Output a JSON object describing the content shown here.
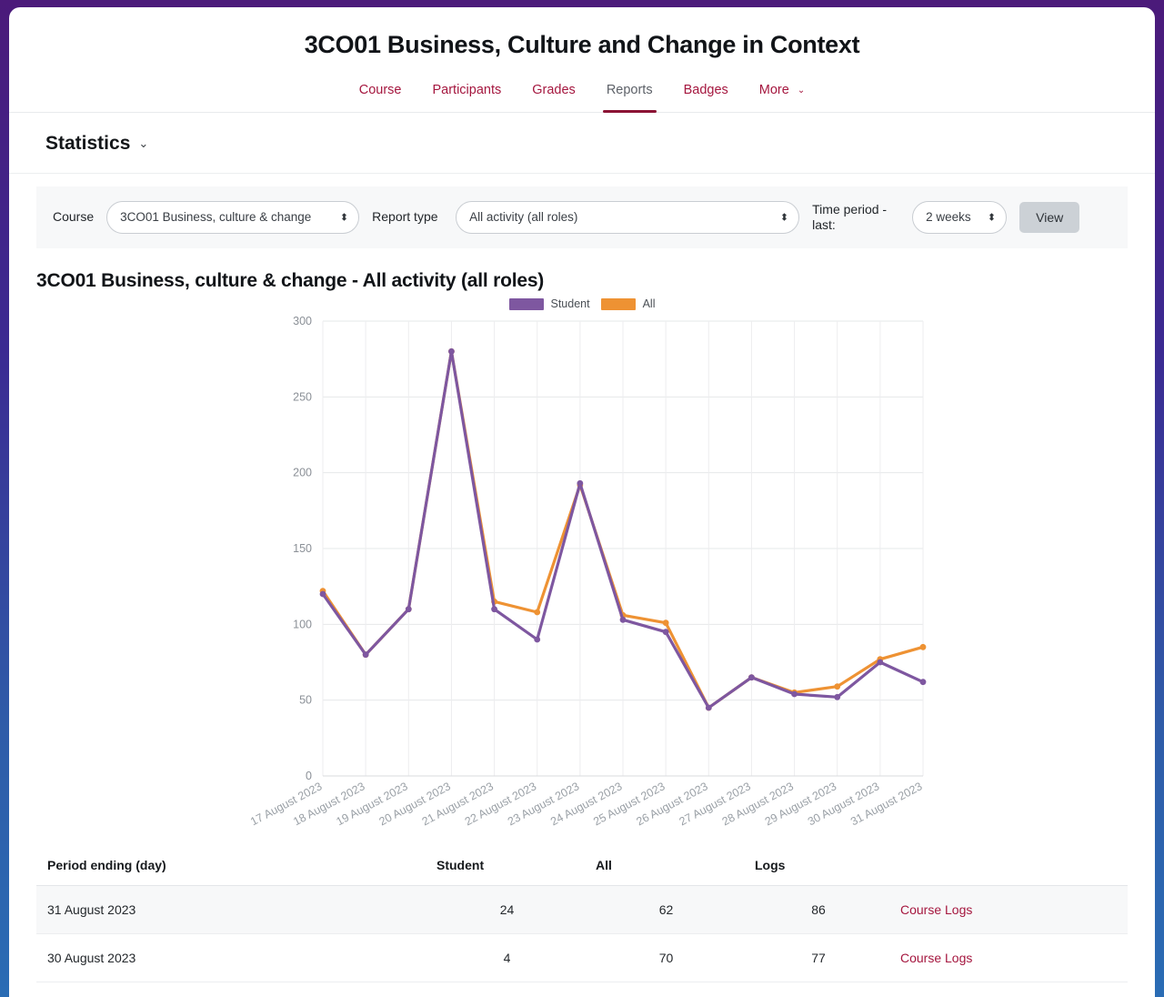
{
  "header": {
    "course_title": "3CO01 Business, Culture and Change in Context",
    "tabs": [
      {
        "label": "Course",
        "active": false
      },
      {
        "label": "Participants",
        "active": false
      },
      {
        "label": "Grades",
        "active": false
      },
      {
        "label": "Reports",
        "active": true
      },
      {
        "label": "Badges",
        "active": false
      },
      {
        "label": "More",
        "active": false,
        "has_chevron": true
      }
    ],
    "more_chevron": "⌄"
  },
  "page": {
    "section_title": "Statistics",
    "section_chevron": "⌄"
  },
  "filters": {
    "course_label": "Course",
    "course_value": "3CO01 Business, culture & change",
    "report_type_label": "Report type",
    "report_type_value": "All activity (all roles)",
    "time_period_label": "Time period - last:",
    "time_period_value": "2 weeks",
    "view_button": "View"
  },
  "report": {
    "title": "3CO01 Business, culture & change - All activity (all roles)"
  },
  "chart_data": {
    "type": "line",
    "title": "",
    "xlabel": "",
    "ylabel": "",
    "ylim": [
      0,
      300
    ],
    "yticks": [
      0,
      50,
      100,
      150,
      200,
      250,
      300
    ],
    "grid": true,
    "legend_position": "top-center",
    "categories": [
      "17 August 2023",
      "18 August 2023",
      "19 August 2023",
      "20 August 2023",
      "21 August 2023",
      "22 August 2023",
      "23 August 2023",
      "24 August 2023",
      "25 August 2023",
      "26 August 2023",
      "27 August 2023",
      "28 August 2023",
      "29 August 2023",
      "30 August 2023",
      "31 August 2023"
    ],
    "series": [
      {
        "name": "Student",
        "color": "#7e57a0",
        "values": [
          120,
          80,
          110,
          280,
          110,
          90,
          193,
          103,
          95,
          45,
          65,
          54,
          52,
          75,
          62
        ]
      },
      {
        "name": "All",
        "color": "#ee9233",
        "values": [
          122,
          80,
          110,
          280,
          115,
          108,
          192,
          106,
          101,
          45,
          65,
          55,
          59,
          77,
          85
        ]
      }
    ]
  },
  "table": {
    "columns": [
      "Period ending (day)",
      "Student",
      "All",
      "Logs",
      ""
    ],
    "rows": [
      {
        "period": "31 August 2023",
        "student": "24",
        "all": "62",
        "logs": "86",
        "link": "Course Logs"
      },
      {
        "period": "30 August 2023",
        "student": "4",
        "all": "70",
        "logs": "77",
        "link": "Course Logs"
      }
    ]
  },
  "colors": {
    "brand_purple": "#4b1a7a",
    "brand_blue": "#2a6cb4",
    "link_crimson": "#a5173f",
    "student_series": "#7e57a0",
    "all_series": "#ee9233"
  }
}
